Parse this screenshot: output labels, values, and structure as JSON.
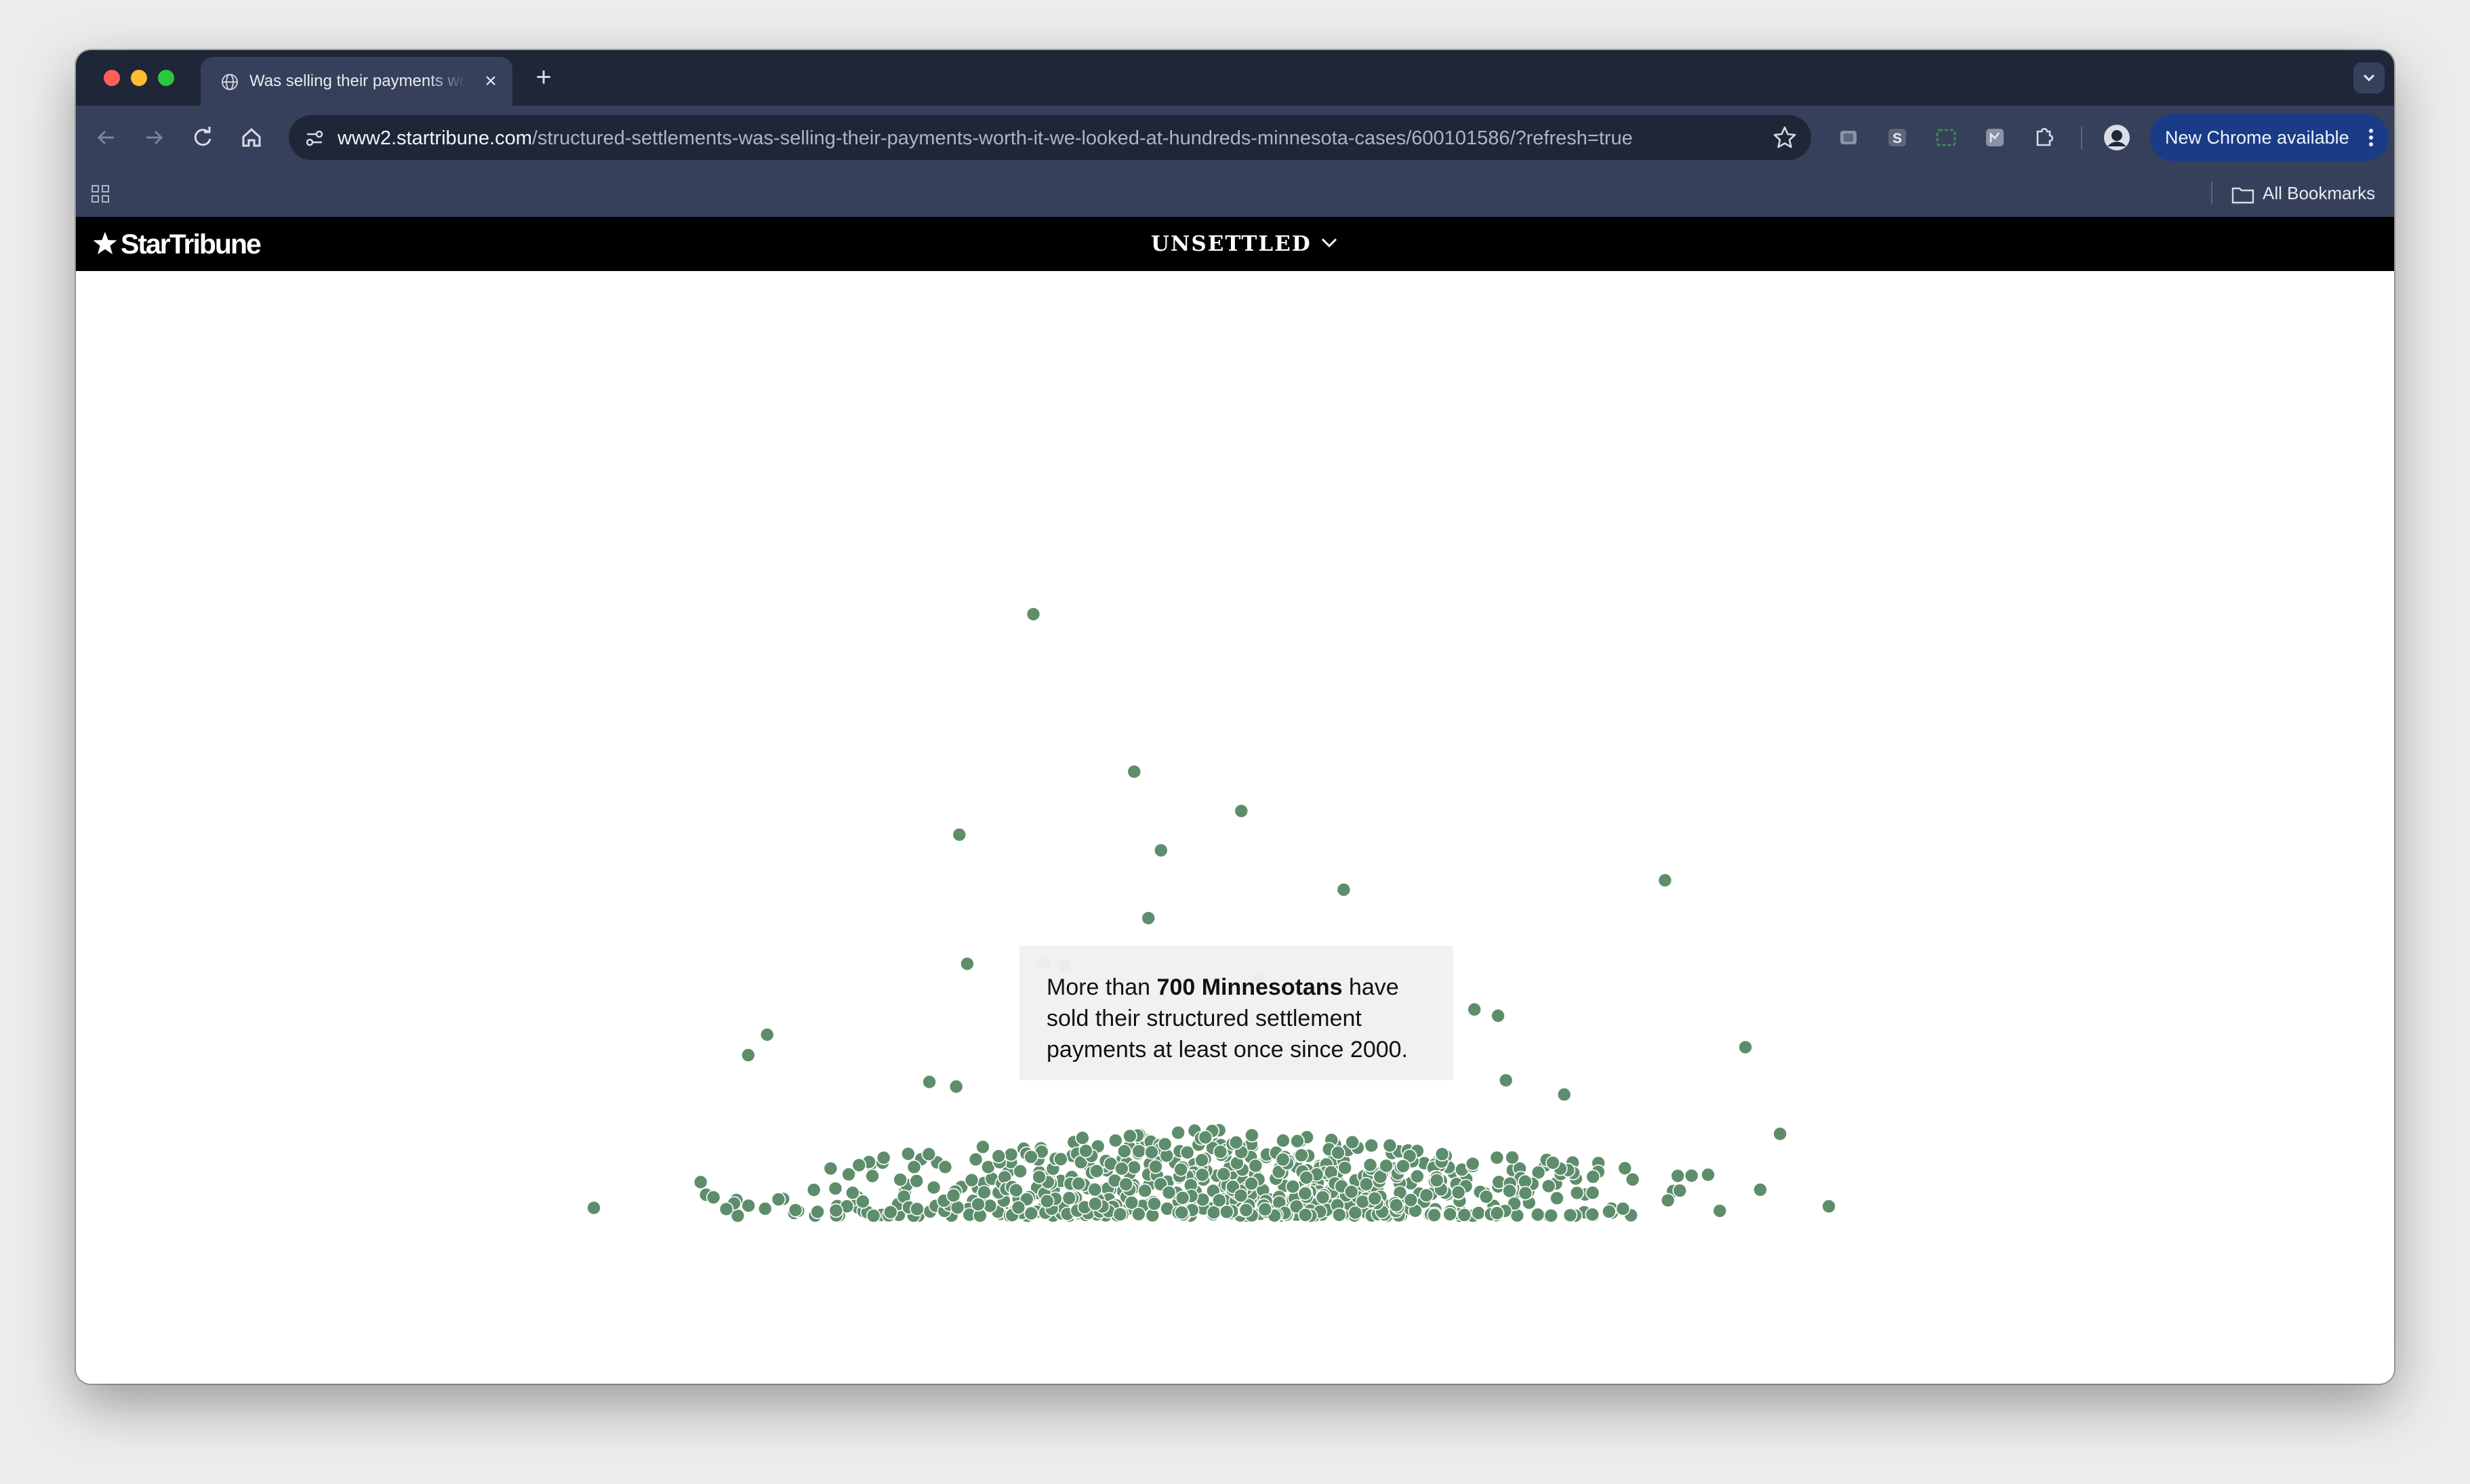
{
  "browser": {
    "tab": {
      "title": "Was selling their payments worth it? We looked at hundreds of Minnesota cases"
    },
    "address_bar": {
      "host": "www2.startribune.com",
      "path": "/structured-settlements-was-selling-their-payments-worth-it-we-looked-at-hundreds-minnesota-cases/600101586/?refresh=true"
    },
    "update_button": "New Chrome available",
    "bookmarks_bar": {
      "all_bookmarks": "All Bookmarks"
    },
    "extension_icons": [
      "extension-puzzle-icon",
      "s-extension-icon",
      "screenshot-extension-icon",
      "grid-extension-icon",
      "extensions-icon"
    ],
    "profile": "profile-avatar-icon"
  },
  "site": {
    "logo": "StarTribune",
    "section": "UNSETTLED"
  },
  "callout": {
    "text_before": "More than ",
    "text_bold": "700 Minnesotans",
    "text_after": " have sold their structured settlement payments at least once since 2000."
  },
  "colors": {
    "dot": "#5e8d6b",
    "dot_stroke": "#ffffff",
    "browser_dark": "#1f2638",
    "browser_toolbar": "#36405a",
    "update_button": "#1a3c86"
  },
  "chart_data": {
    "type": "scatter",
    "title": "",
    "xlabel": "",
    "ylabel": "",
    "note": "",
    "outliers_x": [
      656,
      720,
      788,
      609,
      737,
      853,
      1057,
      729,
      663,
      676,
      614,
      799,
      936,
      951,
      1108,
      487,
      475,
      956,
      993,
      1130,
      590,
      607,
      1161,
      377
    ],
    "outliers_y": [
      390,
      490,
      515,
      530,
      540,
      565,
      559,
      583,
      611,
      613,
      612,
      622,
      641,
      645,
      665,
      657,
      670,
      686,
      695,
      720,
      687,
      690,
      766,
      767
    ],
    "cluster_count": 700
  }
}
